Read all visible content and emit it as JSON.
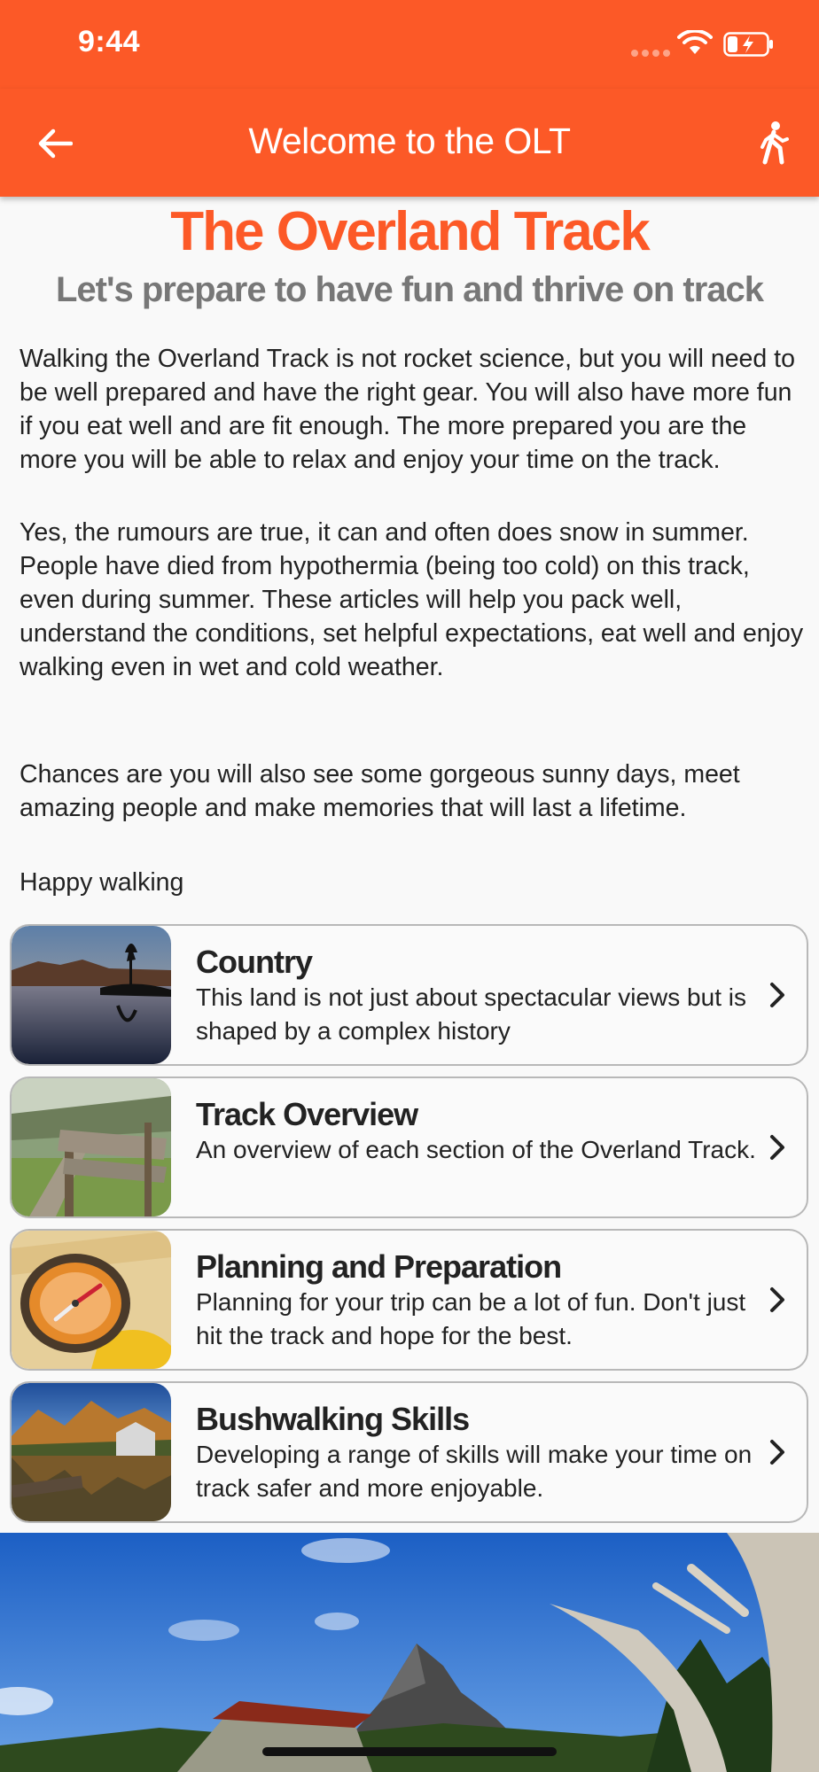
{
  "status_bar": {
    "time": "9:44"
  },
  "nav": {
    "title": "Welcome to the OLT"
  },
  "header": {
    "title": "The Overland Track",
    "subtitle": "Let's prepare to have fun and thrive on track"
  },
  "intro": {
    "p1": "Walking the Overland Track is not rocket science, but you will need to be well prepared and have the right gear. You will also have more fun if you eat well and are fit enough. The more prepared you are the more you will be able to relax and enjoy your time on the track.",
    "p2": "Yes, the rumours are true, it can and often does snow in summer. People have died from hypothermia (being too cold) on this track, even during summer. These articles will help you pack well, understand the conditions, set helpful expectations, eat well and enjoy walking even in wet and cold weather.",
    "p3": "Chances are you will also see some gorgeous sunny days, meet amazing people and make memories that will last a lifetime.",
    "p4": "Happy walking"
  },
  "cards": [
    {
      "title": "Country",
      "description": "This land is not just about spectacular views but is shaped by a complex history"
    },
    {
      "title": "Track Overview",
      "description": "An overview of each section of the Overland Track."
    },
    {
      "title": "Planning and Preparation",
      "description": "Planning for your trip can be a lot of fun. Don't just hit the track and hope for the best."
    },
    {
      "title": "Bushwalking Skills",
      "description": "Developing a range of skills will make your time on track safer and more enjoyable."
    }
  ],
  "colors": {
    "accent": "#fc5927",
    "subtitle": "#777777",
    "card_border": "#b8b8b8"
  },
  "icons": [
    "back-arrow-icon",
    "walking-person-icon",
    "wifi-icon",
    "battery-charging-icon",
    "chevron-right-icon"
  ]
}
